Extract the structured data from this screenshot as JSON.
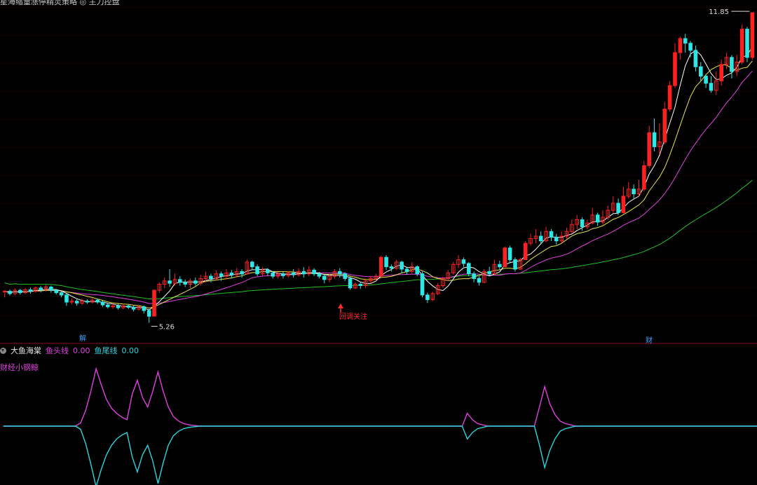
{
  "top_caption": "星海缩量涨停精灵策略 ◎ 主力控盘",
  "main_panel": {
    "price_high_label": "11.85",
    "price_low_label": "5.26",
    "annotation": "回调关注",
    "marker_left": "解",
    "marker_right": "财",
    "colors": {
      "up": "#ff2020",
      "down": "#2ee6e6",
      "ma5": "#ffffff",
      "ma10": "#e6e64a",
      "ma20": "#e040e0",
      "ma60": "#22c022"
    }
  },
  "indicator": {
    "name": "大鱼海棠",
    "head_label": "鱼头线",
    "head_value": "0.00",
    "tail_label": "鱼尾线",
    "tail_value": "0.00",
    "side_label": "财经小钢鲸",
    "colors": {
      "head": "#e040e0",
      "tail": "#2ad4e0"
    }
  },
  "chart_data": [
    {
      "type": "candlestick",
      "title": "",
      "ylim": [
        5.0,
        12.0
      ],
      "candles": [
        [
          5.92,
          5.93,
          5.8,
          5.96
        ],
        [
          5.93,
          5.88,
          5.84,
          5.97
        ],
        [
          5.88,
          5.95,
          5.85,
          5.99
        ],
        [
          5.95,
          5.9,
          5.86,
          5.98
        ],
        [
          5.9,
          5.96,
          5.87,
          6.0
        ],
        [
          5.96,
          5.93,
          5.88,
          6.01
        ],
        [
          5.93,
          6.0,
          5.9,
          6.03
        ],
        [
          6.0,
          5.96,
          5.91,
          6.04
        ],
        [
          5.96,
          6.02,
          5.93,
          6.06
        ],
        [
          6.02,
          5.95,
          5.9,
          6.05
        ],
        [
          5.95,
          5.9,
          5.86,
          5.98
        ],
        [
          5.9,
          5.85,
          5.8,
          5.93
        ],
        [
          5.85,
          5.7,
          5.62,
          5.88
        ],
        [
          5.7,
          5.72,
          5.65,
          5.78
        ],
        [
          5.72,
          5.68,
          5.62,
          5.76
        ],
        [
          5.68,
          5.72,
          5.64,
          5.77
        ],
        [
          5.72,
          5.7,
          5.66,
          5.76
        ],
        [
          5.7,
          5.74,
          5.67,
          5.78
        ],
        [
          5.74,
          5.7,
          5.66,
          5.77
        ],
        [
          5.7,
          5.64,
          5.6,
          5.73
        ],
        [
          5.64,
          5.6,
          5.56,
          5.68
        ],
        [
          5.6,
          5.62,
          5.56,
          5.67
        ],
        [
          5.62,
          5.58,
          5.54,
          5.66
        ],
        [
          5.58,
          5.62,
          5.55,
          5.67
        ],
        [
          5.62,
          5.59,
          5.55,
          5.66
        ],
        [
          5.59,
          5.55,
          5.5,
          5.63
        ],
        [
          5.55,
          5.6,
          5.52,
          5.64
        ],
        [
          5.6,
          5.52,
          5.46,
          5.63
        ],
        [
          5.52,
          5.4,
          5.26,
          5.55
        ],
        [
          5.4,
          5.95,
          5.4,
          5.97
        ],
        [
          5.95,
          6.08,
          5.9,
          6.12
        ],
        [
          6.08,
          6.15,
          6.0,
          6.22
        ],
        [
          6.15,
          6.1,
          6.02,
          6.4
        ],
        [
          6.1,
          6.18,
          6.05,
          6.3
        ],
        [
          6.18,
          6.12,
          6.05,
          6.25
        ],
        [
          6.12,
          6.08,
          6.02,
          6.18
        ],
        [
          6.08,
          6.15,
          6.0,
          6.2
        ],
        [
          6.15,
          6.1,
          6.05,
          6.22
        ],
        [
          6.1,
          6.2,
          6.05,
          6.28
        ],
        [
          6.2,
          6.25,
          6.12,
          6.35
        ],
        [
          6.25,
          6.2,
          6.12,
          6.3
        ],
        [
          6.2,
          6.3,
          6.15,
          6.38
        ],
        [
          6.3,
          6.25,
          6.15,
          6.35
        ],
        [
          6.25,
          6.32,
          6.18,
          6.4
        ],
        [
          6.32,
          6.28,
          6.2,
          6.38
        ],
        [
          6.28,
          6.35,
          6.22,
          6.42
        ],
        [
          6.35,
          6.3,
          6.22,
          6.4
        ],
        [
          6.3,
          6.55,
          6.28,
          6.6
        ],
        [
          6.55,
          6.45,
          6.38,
          6.58
        ],
        [
          6.45,
          6.3,
          6.25,
          6.5
        ],
        [
          6.3,
          6.38,
          6.26,
          6.44
        ],
        [
          6.38,
          6.32,
          6.26,
          6.42
        ],
        [
          6.32,
          6.25,
          6.2,
          6.36
        ],
        [
          6.25,
          6.3,
          6.2,
          6.34
        ],
        [
          6.3,
          6.26,
          6.2,
          6.34
        ],
        [
          6.26,
          6.32,
          6.22,
          6.36
        ],
        [
          6.32,
          6.28,
          6.22,
          6.4
        ],
        [
          6.28,
          6.35,
          6.24,
          6.42
        ],
        [
          6.35,
          6.3,
          6.22,
          6.44
        ],
        [
          6.3,
          6.38,
          6.25,
          6.46
        ],
        [
          6.38,
          6.3,
          6.25,
          6.42
        ],
        [
          6.3,
          6.25,
          6.2,
          6.34
        ],
        [
          6.25,
          6.18,
          6.1,
          6.28
        ],
        [
          6.18,
          6.25,
          6.12,
          6.3
        ],
        [
          6.25,
          6.35,
          6.2,
          6.4
        ],
        [
          6.35,
          6.3,
          6.22,
          6.42
        ],
        [
          6.3,
          6.2,
          6.15,
          6.33
        ],
        [
          6.2,
          6.0,
          5.96,
          6.24
        ],
        [
          6.0,
          6.08,
          5.98,
          6.12
        ],
        [
          6.08,
          6.05,
          5.98,
          6.12
        ],
        [
          6.05,
          6.15,
          6.0,
          6.2
        ],
        [
          6.15,
          6.2,
          6.1,
          6.25
        ],
        [
          6.2,
          6.25,
          6.15,
          6.3
        ],
        [
          6.25,
          6.65,
          6.22,
          6.68
        ],
        [
          6.65,
          6.45,
          6.38,
          6.7
        ],
        [
          6.45,
          6.42,
          6.35,
          6.5
        ],
        [
          6.42,
          6.55,
          6.38,
          6.6
        ],
        [
          6.55,
          6.4,
          6.32,
          6.58
        ],
        [
          6.4,
          6.35,
          6.28,
          6.45
        ],
        [
          6.35,
          6.45,
          6.3,
          6.55
        ],
        [
          6.45,
          6.3,
          6.25,
          6.48
        ],
        [
          6.3,
          5.85,
          5.8,
          6.35
        ],
        [
          5.85,
          5.75,
          5.68,
          5.9
        ],
        [
          5.75,
          5.88,
          5.72,
          5.92
        ],
        [
          5.88,
          6.05,
          5.85,
          6.1
        ],
        [
          6.05,
          6.2,
          6.0,
          6.24
        ],
        [
          6.2,
          6.32,
          6.15,
          6.38
        ],
        [
          6.32,
          6.5,
          6.28,
          6.55
        ],
        [
          6.5,
          6.6,
          6.42,
          6.7
        ],
        [
          6.6,
          6.52,
          6.45,
          6.65
        ],
        [
          6.52,
          6.3,
          6.25,
          6.55
        ],
        [
          6.3,
          6.2,
          6.12,
          6.35
        ],
        [
          6.2,
          6.12,
          6.05,
          6.25
        ],
        [
          6.12,
          6.35,
          6.1,
          6.4
        ],
        [
          6.35,
          6.3,
          6.25,
          6.45
        ],
        [
          6.3,
          6.5,
          6.28,
          6.6
        ],
        [
          6.5,
          6.45,
          6.38,
          6.58
        ],
        [
          6.45,
          6.85,
          6.45,
          6.88
        ],
        [
          6.85,
          6.6,
          6.52,
          6.9
        ],
        [
          6.6,
          6.4,
          6.35,
          6.65
        ],
        [
          6.4,
          6.6,
          6.38,
          6.64
        ],
        [
          6.6,
          6.95,
          6.6,
          7.0
        ],
        [
          6.95,
          7.05,
          6.9,
          7.15
        ],
        [
          7.05,
          7.1,
          6.95,
          7.25
        ],
        [
          7.1,
          7.0,
          6.92,
          7.2
        ],
        [
          7.0,
          7.2,
          6.98,
          7.3
        ],
        [
          7.2,
          7.08,
          7.0,
          7.25
        ],
        [
          7.08,
          7.0,
          6.92,
          7.15
        ],
        [
          7.0,
          7.1,
          6.95,
          7.2
        ],
        [
          7.1,
          7.2,
          7.05,
          7.28
        ],
        [
          7.2,
          7.35,
          7.15,
          7.45
        ],
        [
          7.35,
          7.45,
          7.25,
          7.55
        ],
        [
          7.45,
          7.3,
          7.22,
          7.5
        ],
        [
          7.3,
          7.38,
          7.25,
          7.45
        ],
        [
          7.38,
          7.55,
          7.35,
          7.7
        ],
        [
          7.55,
          7.4,
          7.32,
          7.6
        ],
        [
          7.4,
          7.5,
          7.35,
          7.65
        ],
        [
          7.5,
          7.65,
          7.45,
          7.75
        ],
        [
          7.65,
          7.8,
          7.6,
          7.95
        ],
        [
          7.8,
          7.6,
          7.55,
          7.9
        ],
        [
          7.6,
          7.95,
          7.58,
          8.15
        ],
        [
          7.95,
          8.1,
          7.9,
          8.25
        ],
        [
          8.1,
          8.0,
          7.9,
          8.2
        ],
        [
          8.0,
          8.1,
          7.95,
          8.3
        ],
        [
          8.1,
          8.6,
          8.05,
          8.7
        ],
        [
          8.6,
          9.3,
          8.55,
          9.45
        ],
        [
          9.3,
          9.0,
          8.9,
          9.6
        ],
        [
          9.0,
          9.1,
          8.85,
          9.5
        ],
        [
          9.1,
          9.8,
          9.05,
          9.95
        ],
        [
          9.8,
          10.3,
          9.75,
          10.4
        ],
        [
          10.3,
          11.0,
          10.25,
          11.2
        ],
        [
          11.0,
          11.3,
          10.85,
          11.35
        ],
        [
          11.3,
          11.2,
          11.0,
          11.4
        ],
        [
          11.2,
          11.05,
          10.9,
          11.25
        ],
        [
          11.05,
          10.7,
          10.6,
          11.15
        ],
        [
          10.7,
          10.5,
          10.4,
          10.8
        ],
        [
          10.5,
          10.35,
          10.25,
          10.55
        ],
        [
          10.35,
          10.2,
          10.15,
          10.5
        ],
        [
          10.2,
          10.4,
          10.1,
          10.6
        ],
        [
          10.4,
          10.75,
          10.3,
          10.85
        ],
        [
          10.75,
          10.9,
          10.65,
          11.0
        ],
        [
          10.9,
          10.6,
          10.45,
          10.95
        ],
        [
          10.6,
          10.8,
          10.5,
          10.95
        ],
        [
          10.8,
          11.5,
          10.75,
          11.6
        ],
        [
          11.5,
          10.9,
          10.8,
          11.55
        ],
        [
          10.9,
          11.85,
          10.85,
          11.85
        ]
      ]
    },
    {
      "type": "line",
      "title": "",
      "ylim": [
        -1,
        1
      ],
      "series": [
        {
          "name": "鱼头线",
          "values": [
            0.0,
            0.0,
            0.0,
            0.0,
            0.0,
            0.0,
            0.0,
            0.0,
            0.0,
            0.0,
            0.0,
            0.0,
            0.0,
            0.0,
            0.0,
            0.05,
            0.25,
            0.55,
            0.9,
            0.65,
            0.42,
            0.28,
            0.2,
            0.14,
            0.1,
            0.5,
            0.72,
            0.45,
            0.3,
            0.55,
            0.85,
            0.55,
            0.3,
            0.15,
            0.08,
            0.04,
            0.02,
            0.01,
            0.0,
            0.0,
            0.0,
            0.0,
            0.0,
            0.0,
            0.0,
            0.0,
            0.0,
            0.0,
            0.0,
            0.0,
            0.0,
            0.0,
            0.0,
            0.0,
            0.0,
            0.0,
            0.0,
            0.0,
            0.0,
            0.0,
            0.0,
            0.0,
            0.0,
            0.0,
            0.0,
            0.0,
            0.0,
            0.0,
            0.0,
            0.0,
            0.0,
            0.0,
            0.0,
            0.0,
            0.0,
            0.0,
            0.0,
            0.0,
            0.0,
            0.0,
            0.0,
            0.0,
            0.0,
            0.0,
            0.0,
            0.0,
            0.0,
            0.0,
            0.0,
            0.0,
            0.2,
            0.1,
            0.04,
            0.02,
            0.0,
            0.0,
            0.0,
            0.0,
            0.0,
            0.0,
            0.0,
            0.0,
            0.0,
            0.0,
            0.3,
            0.62,
            0.35,
            0.18,
            0.08,
            0.04,
            0.02,
            0.0,
            0.0,
            0.0,
            0.0,
            0.0,
            0.0,
            0.0,
            0.0,
            0.0,
            0.0,
            0.0,
            0.0,
            0.0,
            0.0,
            0.0,
            0.0,
            0.0,
            0.0,
            0.0,
            0.0,
            0.0,
            0.0,
            0.0,
            0.0,
            0.0,
            0.0,
            0.0,
            0.0,
            0.0,
            0.0,
            0.0,
            0.0,
            0.0,
            0.0,
            0.0,
            0.0,
            0.0,
            0.0,
            0.0,
            0.0,
            0.0,
            0.0,
            0.0,
            0.0,
            0.0
          ]
        },
        {
          "name": "鱼尾线",
          "values": [
            0.0,
            0.0,
            0.0,
            0.0,
            0.0,
            0.0,
            0.0,
            0.0,
            0.0,
            0.0,
            0.0,
            0.0,
            0.0,
            0.0,
            0.0,
            -0.05,
            -0.28,
            -0.6,
            -0.95,
            -0.68,
            -0.45,
            -0.3,
            -0.2,
            -0.14,
            -0.1,
            -0.48,
            -0.72,
            -0.45,
            -0.3,
            -0.55,
            -0.9,
            -0.58,
            -0.3,
            -0.15,
            -0.08,
            -0.04,
            -0.02,
            -0.01,
            0.0,
            0.0,
            0.0,
            0.0,
            0.0,
            0.0,
            0.0,
            0.0,
            0.0,
            0.0,
            0.0,
            0.0,
            0.0,
            0.0,
            0.0,
            0.0,
            0.0,
            0.0,
            0.0,
            0.0,
            0.0,
            0.0,
            0.0,
            0.0,
            0.0,
            0.0,
            0.0,
            0.0,
            0.0,
            0.0,
            0.0,
            0.0,
            0.0,
            0.0,
            0.0,
            0.0,
            0.0,
            0.0,
            0.0,
            0.0,
            0.0,
            0.0,
            0.0,
            0.0,
            0.0,
            0.0,
            0.0,
            0.0,
            0.0,
            0.0,
            0.0,
            0.0,
            -0.2,
            -0.1,
            -0.04,
            -0.02,
            0.0,
            0.0,
            0.0,
            0.0,
            0.0,
            0.0,
            0.0,
            0.0,
            0.0,
            0.0,
            -0.3,
            -0.65,
            -0.38,
            -0.2,
            -0.08,
            -0.04,
            -0.02,
            0.0,
            0.0,
            0.0,
            0.0,
            0.0,
            0.0,
            0.0,
            0.0,
            0.0,
            0.0,
            0.0,
            0.0,
            0.0,
            0.0,
            0.0,
            0.0,
            0.0,
            0.0,
            0.0,
            0.0,
            0.0,
            0.0,
            0.0,
            0.0,
            0.0,
            0.0,
            0.0,
            0.0,
            0.0,
            0.0,
            0.0,
            0.0,
            0.0,
            0.0,
            0.0,
            0.0,
            0.0,
            0.0,
            0.0,
            0.0,
            0.0,
            0.0,
            0.0,
            0.0,
            0.0
          ]
        }
      ]
    }
  ]
}
